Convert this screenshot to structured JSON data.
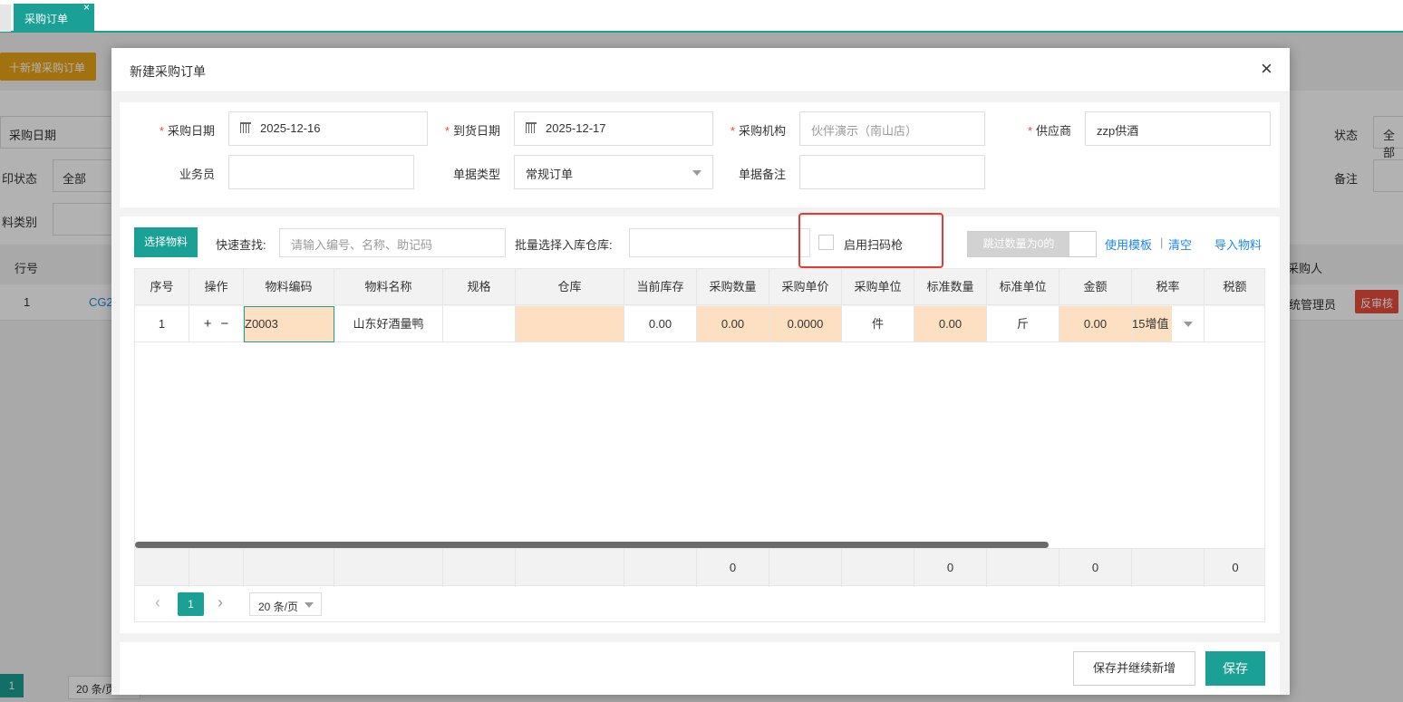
{
  "tabs": [
    {
      "label": "采购订单",
      "close": "×"
    }
  ],
  "background": {
    "add_button": "十新增采购订单",
    "filters": [
      {
        "label": "采购日期"
      },
      {
        "label": "状态",
        "value": "全部"
      },
      {
        "label": "印状态",
        "value": "全部"
      },
      {
        "label": "备注",
        "value": ""
      },
      {
        "label": "料类别",
        "value": ""
      }
    ],
    "table_headers": {
      "row_no": "行号",
      "buyer": "采购人"
    },
    "row": {
      "no": "1",
      "code": "CG2",
      "buyer": "统管理员",
      "action": "反审核"
    },
    "pagination": {
      "page": "1",
      "size": "20 条/页"
    }
  },
  "modal": {
    "title": "新建采购订单",
    "close": "×",
    "form": {
      "purchase_date": {
        "label": "采购日期",
        "value": "2025-12-16"
      },
      "arrival_date": {
        "label": "到货日期",
        "value": "2025-12-17"
      },
      "org": {
        "label": "采购机构",
        "placeholder": "伙伴演示（南山店）"
      },
      "supplier": {
        "label": "供应商",
        "value": "zzp供酒"
      },
      "salesman": {
        "label": "业务员",
        "value": ""
      },
      "doc_type": {
        "label": "单据类型",
        "value": "常规订单"
      },
      "remark": {
        "label": "单据备注",
        "value": ""
      }
    },
    "toolbar": {
      "select_material": "选择物料",
      "quick_search_label": "快速查找:",
      "quick_search_placeholder": "请输入编号、名称、助记码",
      "batch_warehouse_label": "批量选择入库仓库:",
      "scanner_label": "启用扫码枪",
      "skip_zero": "跳过数量为0的",
      "use_template": "使用模板",
      "separator": "|",
      "clear": "清空",
      "import": "导入物料"
    },
    "table": {
      "headers": [
        "序号",
        "操作",
        "物料编码",
        "物料名称",
        "规格",
        "仓库",
        "当前库存",
        "采购数量",
        "采购单价",
        "采购单位",
        "标准数量",
        "标准单位",
        "金额",
        "税率",
        "税额"
      ],
      "row": {
        "no": "1",
        "add": "+",
        "remove": "−",
        "code": "Z0003",
        "name": "山东好酒量鸭",
        "spec": "",
        "warehouse": "",
        "stock": "0.00",
        "qty": "0.00",
        "price": "0.0000",
        "unit": "件",
        "std_qty": "0.00",
        "std_unit": "斤",
        "amount": "0.00",
        "tax_rate": "15增值",
        "tax": ""
      },
      "footer": {
        "qty": "0",
        "std_qty": "0",
        "amount": "0",
        "tax": "0"
      }
    },
    "pagination": {
      "prev": "‹",
      "page": "1",
      "next": "›",
      "size": "20 条/页"
    },
    "buttons": {
      "save_continue": "保存并继续新增",
      "save": "保存"
    }
  }
}
